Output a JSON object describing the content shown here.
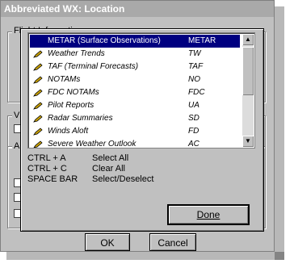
{
  "window": {
    "title": "Abbreviated WX: Location"
  },
  "groups": {
    "flight_info": "Flight Information",
    "g2": "V",
    "g3": "A"
  },
  "list": {
    "items": [
      {
        "name": "METAR (Surface Observations)",
        "code": "METAR",
        "selected": true
      },
      {
        "name": "Weather Trends",
        "code": "TW"
      },
      {
        "name": "TAF (Terminal Forecasts)",
        "code": "TAF"
      },
      {
        "name": "NOTAMs",
        "code": "NO"
      },
      {
        "name": "FDC NOTAMs",
        "code": "FDC"
      },
      {
        "name": "Pilot Reports",
        "code": "UA"
      },
      {
        "name": "Radar Summaries",
        "code": "SD"
      },
      {
        "name": "Winds Aloft",
        "code": "FD"
      },
      {
        "name": "Severe Weather Outlook",
        "code": "AC"
      }
    ]
  },
  "shortcuts": [
    {
      "keys": "CTRL + A",
      "action": "Select All"
    },
    {
      "keys": "CTRL + C",
      "action": "Clear All"
    },
    {
      "keys": "SPACE BAR",
      "action": "Select/Deselect"
    }
  ],
  "buttons": {
    "done": "Done",
    "ok": "OK",
    "cancel": "Cancel"
  },
  "colors": {
    "selection": "#000080",
    "icon_pencil": "#c8a000"
  }
}
